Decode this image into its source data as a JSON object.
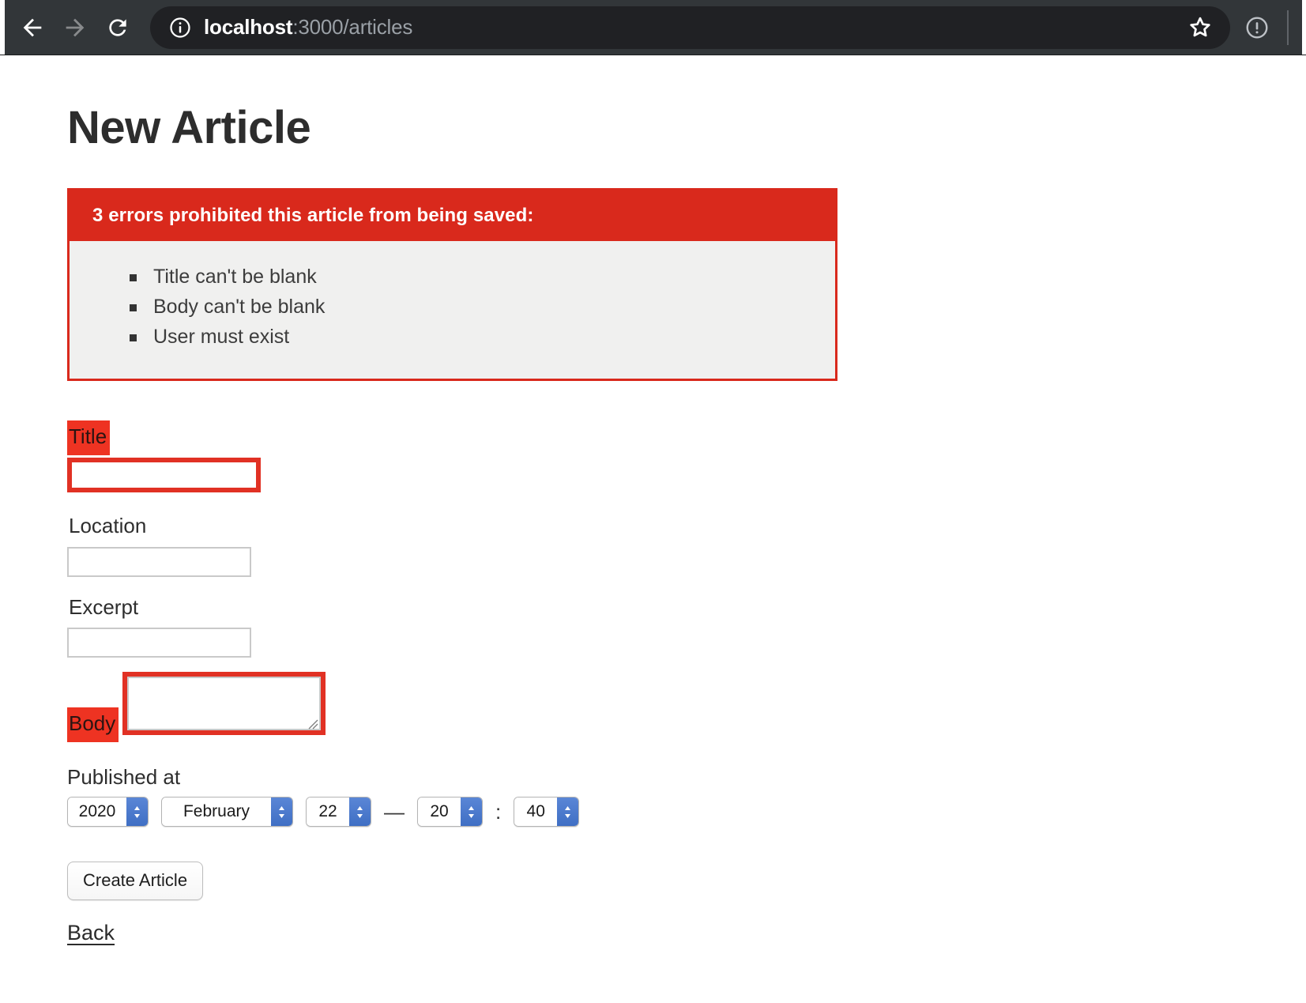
{
  "browser": {
    "back_label": "back-arrow",
    "forward_label": "forward-arrow",
    "reload_label": "reload",
    "site_info_label": "site-information",
    "url_host": "localhost",
    "url_rest": ":3000/articles",
    "bookmark_label": "bookmark-star",
    "update_label": "browser-update"
  },
  "page": {
    "title": "New Article"
  },
  "error_box": {
    "heading": "3 errors prohibited this article from being saved:",
    "errors": [
      "Title can't be blank",
      "Body can't be blank",
      "User must exist"
    ],
    "banner_color": "#d9291c",
    "body_color": "#f0f0ef"
  },
  "form": {
    "fields": [
      {
        "label": "Title",
        "value": "",
        "placeholder": "",
        "has_error": true
      },
      {
        "label": "Location",
        "value": "",
        "placeholder": "",
        "has_error": false
      },
      {
        "label": "Excerpt",
        "value": "",
        "placeholder": "",
        "has_error": false
      },
      {
        "label": "Body",
        "value": "",
        "placeholder": "",
        "has_error": true
      }
    ],
    "published_at": {
      "label": "Published at",
      "year": "2020",
      "month": "February",
      "day": "22",
      "date_time_separator": "—",
      "hour": "20",
      "time_separator": ":",
      "minute": "40"
    },
    "submit_label": "Create Article",
    "back_label": "Back",
    "error_accent": "#ee3322"
  }
}
